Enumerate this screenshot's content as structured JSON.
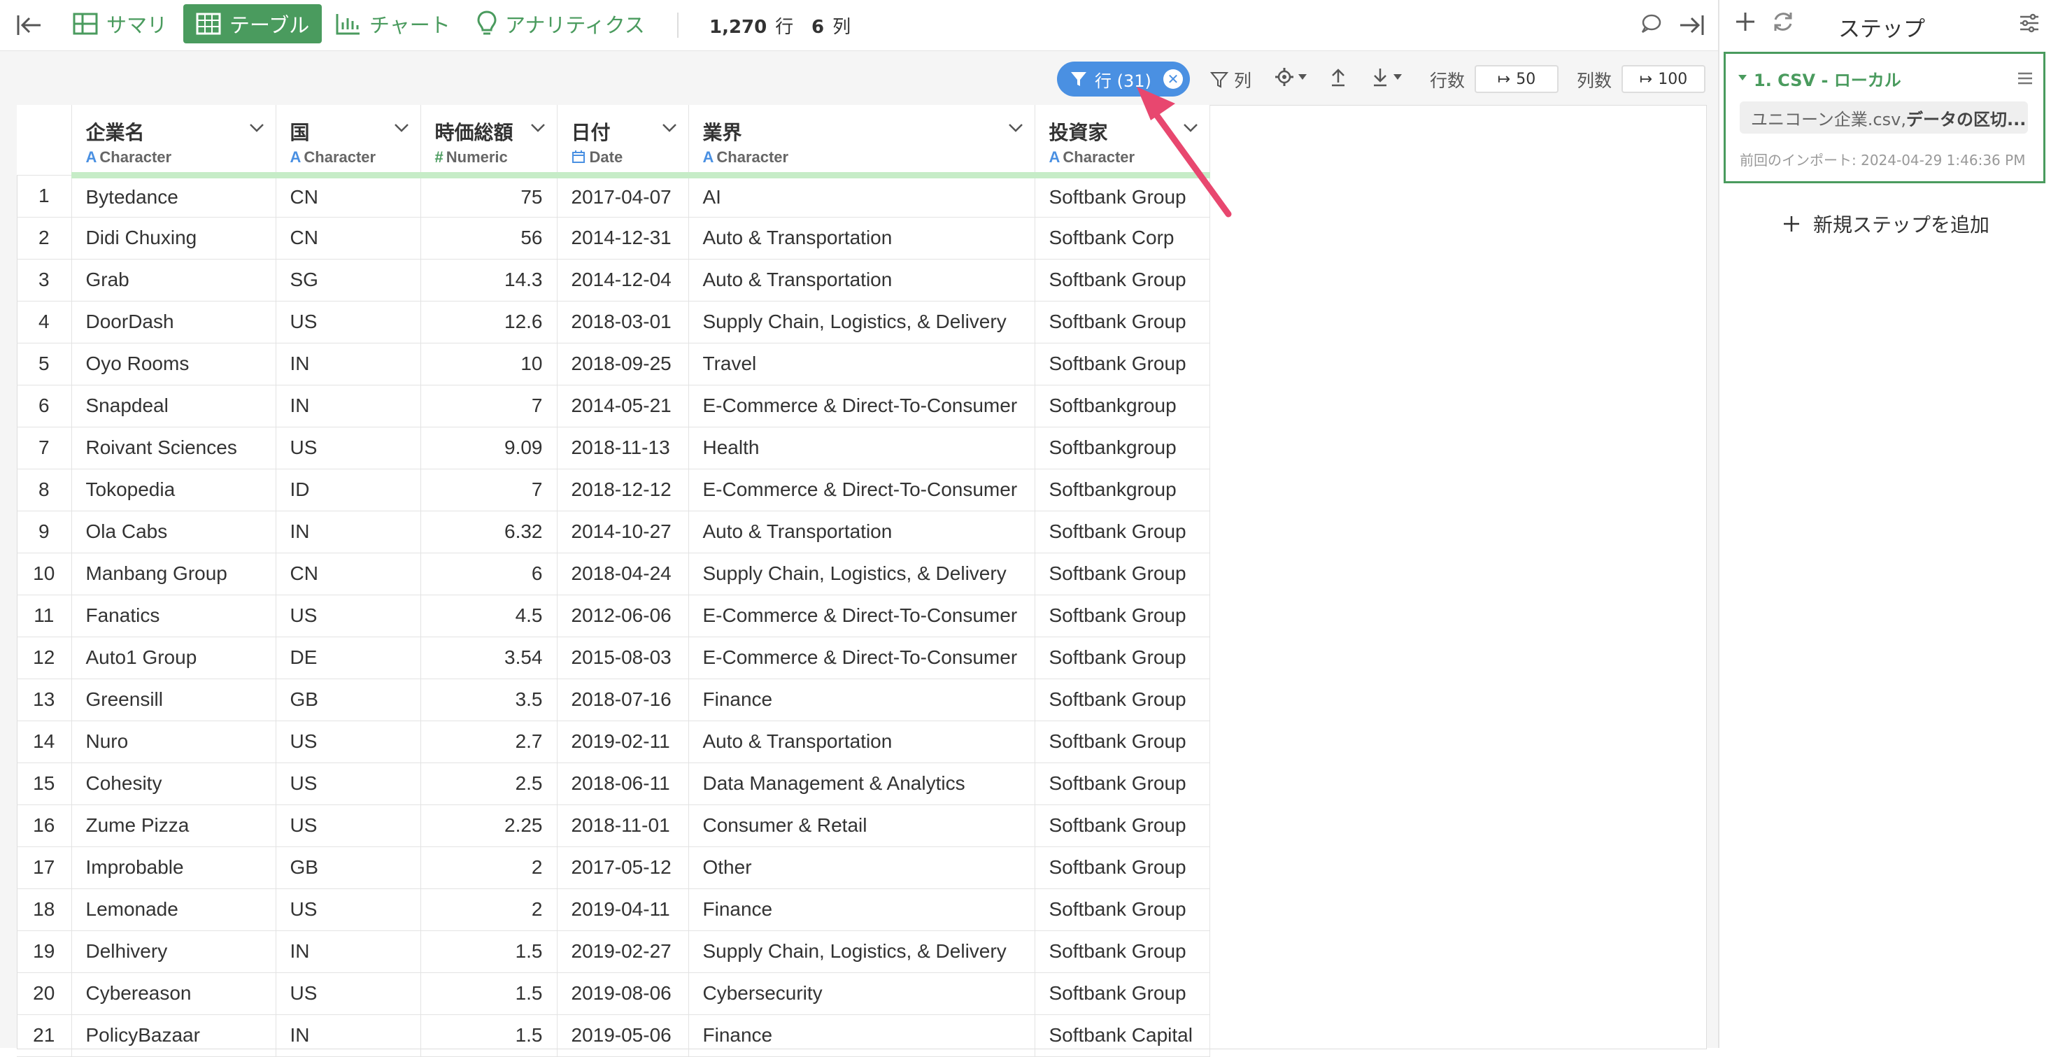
{
  "topbar": {
    "summary": "サマリ",
    "table": "テーブル",
    "chart": "チャート",
    "analytics": "アナリティクス",
    "rows_count": "1,270",
    "rows_unit": "行",
    "cols_count": "6",
    "cols_unit": "列"
  },
  "toolbar": {
    "row_filter": "行 (31)",
    "col_filter": "列",
    "rows_label": "行数",
    "rows_value": "50",
    "cols_label": "列数",
    "cols_value": "100"
  },
  "columns": [
    {
      "name": "企業名",
      "type_letter": "A",
      "type": "Character"
    },
    {
      "name": "国",
      "type_letter": "A",
      "type": "Character"
    },
    {
      "name": "時価総額",
      "type_letter": "#",
      "type": "Numeric"
    },
    {
      "name": "日付",
      "type_letter": "",
      "type": "Date"
    },
    {
      "name": "業界",
      "type_letter": "A",
      "type": "Character"
    },
    {
      "name": "投資家",
      "type_letter": "A",
      "type": "Character"
    }
  ],
  "rows": [
    [
      "1",
      "Bytedance",
      "CN",
      "75",
      "2017-04-07",
      "AI",
      "Softbank Group"
    ],
    [
      "2",
      "Didi Chuxing",
      "CN",
      "56",
      "2014-12-31",
      "Auto & Transportation",
      "Softbank Corp"
    ],
    [
      "3",
      "Grab",
      "SG",
      "14.3",
      "2014-12-04",
      "Auto & Transportation",
      "Softbank Group"
    ],
    [
      "4",
      "DoorDash",
      "US",
      "12.6",
      "2018-03-01",
      "Supply Chain, Logistics, & Delivery",
      "Softbank Group"
    ],
    [
      "5",
      "Oyo Rooms",
      "IN",
      "10",
      "2018-09-25",
      "Travel",
      "Softbank Group"
    ],
    [
      "6",
      "Snapdeal",
      "IN",
      "7",
      "2014-05-21",
      "E-Commerce & Direct-To-Consumer",
      "Softbankgroup"
    ],
    [
      "7",
      "Roivant Sciences",
      "US",
      "9.09",
      "2018-11-13",
      "Health",
      "Softbankgroup"
    ],
    [
      "8",
      "Tokopedia",
      "ID",
      "7",
      "2018-12-12",
      "E-Commerce & Direct-To-Consumer",
      "Softbankgroup"
    ],
    [
      "9",
      "Ola Cabs",
      "IN",
      "6.32",
      "2014-10-27",
      "Auto & Transportation",
      "Softbank Group"
    ],
    [
      "10",
      "Manbang Group",
      "CN",
      "6",
      "2018-04-24",
      "Supply Chain, Logistics, & Delivery",
      "Softbank Group"
    ],
    [
      "11",
      "Fanatics",
      "US",
      "4.5",
      "2012-06-06",
      "E-Commerce & Direct-To-Consumer",
      "Softbank Group"
    ],
    [
      "12",
      "Auto1 Group",
      "DE",
      "3.54",
      "2015-08-03",
      "E-Commerce & Direct-To-Consumer",
      "Softbank Group"
    ],
    [
      "13",
      "Greensill",
      "GB",
      "3.5",
      "2018-07-16",
      "Finance",
      "Softbank Group"
    ],
    [
      "14",
      "Nuro",
      "US",
      "2.7",
      "2019-02-11",
      "Auto & Transportation",
      "Softbank Group"
    ],
    [
      "15",
      "Cohesity",
      "US",
      "2.5",
      "2018-06-11",
      "Data Management & Analytics",
      "Softbank Group"
    ],
    [
      "16",
      "Zume Pizza",
      "US",
      "2.25",
      "2018-11-01",
      "Consumer & Retail",
      "Softbank Group"
    ],
    [
      "17",
      "Improbable",
      "GB",
      "2",
      "2017-05-12",
      "Other",
      "Softbank Group"
    ],
    [
      "18",
      "Lemonade",
      "US",
      "2",
      "2019-04-11",
      "Finance",
      "Softbank Group"
    ],
    [
      "19",
      "Delhivery",
      "IN",
      "1.5",
      "2019-02-27",
      "Supply Chain, Logistics, & Delivery",
      "Softbank Group"
    ],
    [
      "20",
      "Cybereason",
      "US",
      "1.5",
      "2019-08-06",
      "Cybersecurity",
      "Softbank Group"
    ],
    [
      "21",
      "PolicyBazaar",
      "IN",
      "1.5",
      "2019-05-06",
      "Finance",
      "Softbank Capital"
    ]
  ],
  "steps_panel": {
    "title": "ステップ",
    "step_title": "1. CSV - ローカル",
    "step_file": "ユニコーン企業.csv,",
    "step_desc": " データの区切...",
    "step_meta": "前回のインポート: 2024-04-29 1:46:36 PM",
    "add_step": "新規ステップを追加"
  },
  "colors": {
    "accent_green": "#4a9b5e",
    "filter_blue": "#4a90e2",
    "arrow_pink": "#e8476f"
  }
}
